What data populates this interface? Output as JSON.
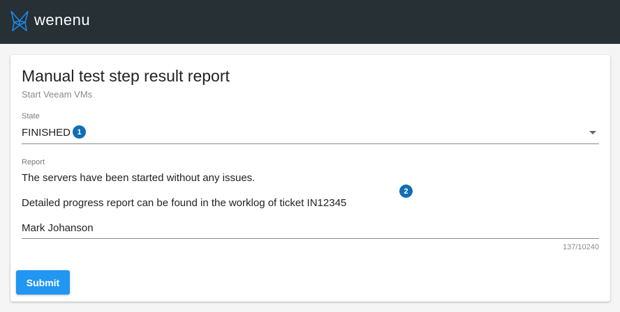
{
  "app": {
    "name": "wenenu"
  },
  "form": {
    "title": "Manual test step result report",
    "subtitle": "Start Veeam VMs",
    "state_label": "State",
    "state_value": "FINISHED",
    "report_label": "Report",
    "report_lines": [
      "The servers have been started without any issues.",
      "Detailed progress report can be found in the worklog of ticket IN12345",
      "Mark Johanson"
    ],
    "char_counter": "137/10240",
    "submit_label": "Submit"
  },
  "annotations": {
    "badge_1": "1",
    "badge_2": "2"
  },
  "colors": {
    "topbar": "#263035",
    "logo_accent": "#1e88e5",
    "badge": "#0f6fb2",
    "submit": "#2196f3"
  },
  "icons": {
    "logo": "wenenu-logo-icon",
    "dropdown": "chevron-down-icon"
  }
}
